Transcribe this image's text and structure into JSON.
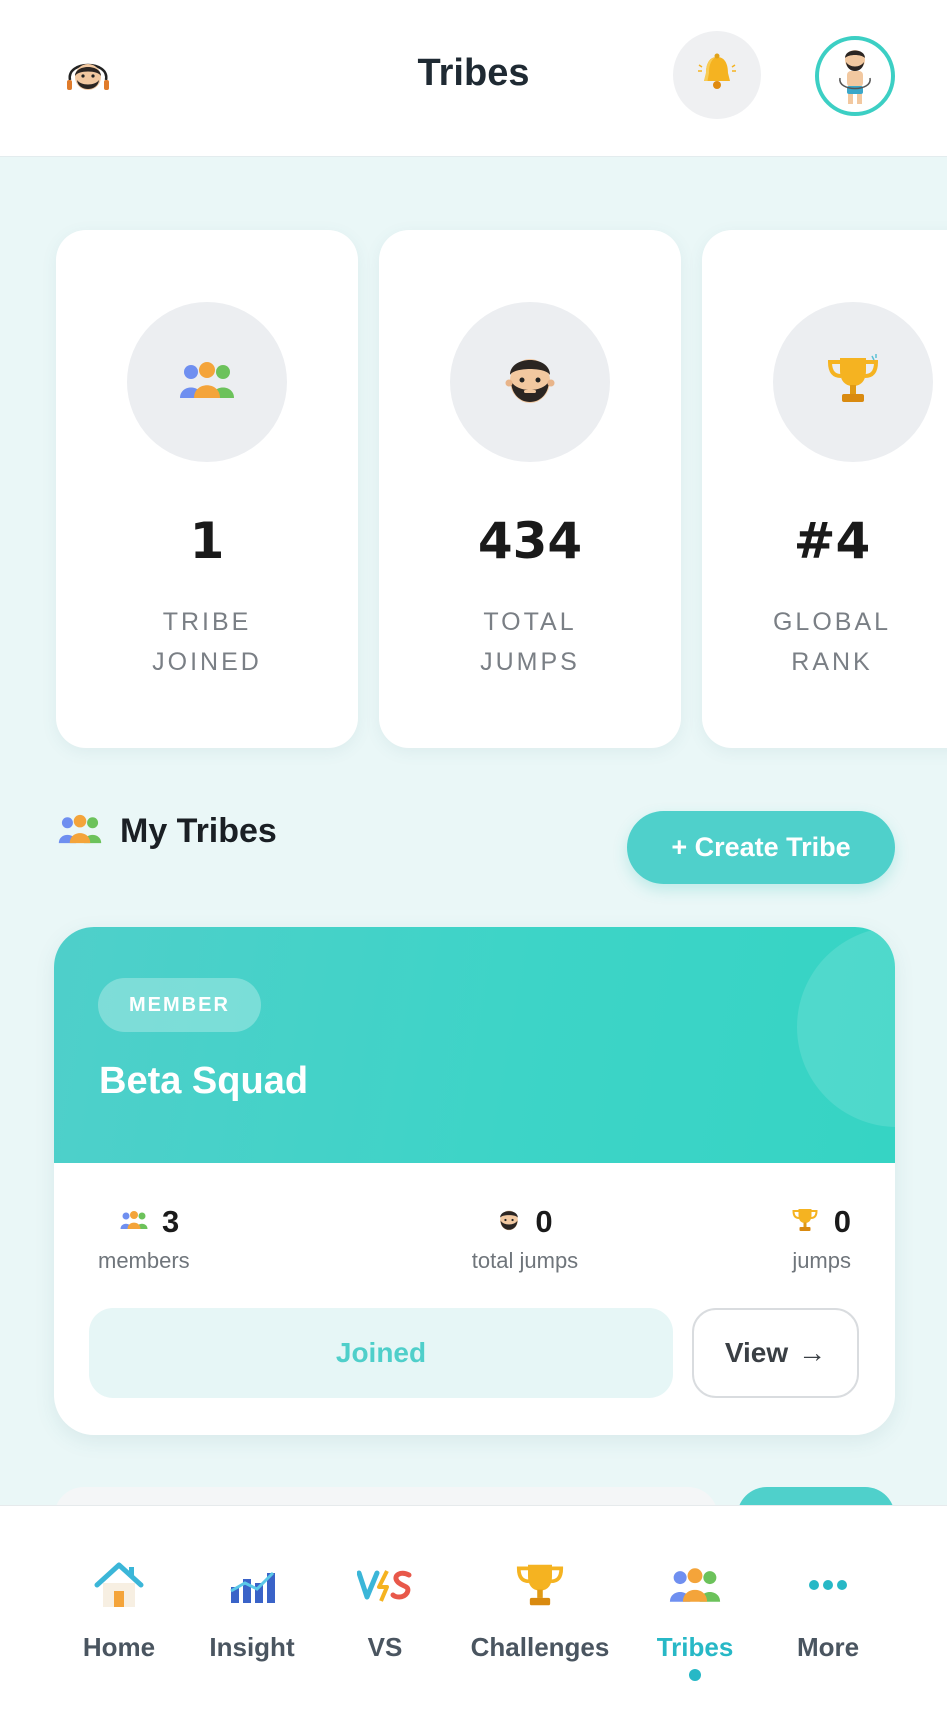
{
  "header": {
    "title": "Tribes",
    "logo_icon": "jump-rope-man-icon",
    "bell_icon": "bell-icon",
    "avatar_icon": "user-avatar-icon"
  },
  "stats": [
    {
      "icon": "group-icon",
      "value": "1",
      "label_line1": "TRIBE",
      "label_line2": "JOINED"
    },
    {
      "icon": "bearded-face-icon",
      "value": "434",
      "label_line1": "TOTAL",
      "label_line2": "JUMPS"
    },
    {
      "icon": "trophy-icon",
      "value": "#4",
      "label_line1": "GLOBAL",
      "label_line2": "RANK"
    }
  ],
  "section": {
    "title": "My Tribes",
    "create_label": "+ Create Tribe"
  },
  "tribe": {
    "badge": "MEMBER",
    "name": "Beta Squad",
    "members_value": "3",
    "members_caption": "members",
    "total_jumps_value": "0",
    "total_jumps_caption": "total jumps",
    "jumps_value": "0",
    "jumps_caption": "jumps",
    "joined_label": "Joined",
    "view_label": "View",
    "view_arrow": "→"
  },
  "nav": [
    {
      "label": "Home",
      "icon": "home-icon"
    },
    {
      "label": "Insight",
      "icon": "chart-icon"
    },
    {
      "label": "VS",
      "icon": "versus-icon"
    },
    {
      "label": "Challenges",
      "icon": "trophy-icon"
    },
    {
      "label": "Tribes",
      "icon": "group-icon",
      "active": true
    },
    {
      "label": "More",
      "icon": "more-dots-icon"
    }
  ],
  "colors": {
    "accent": "#4fd0cb",
    "active_nav": "#27b8c6",
    "background": "#eaf7f7"
  }
}
